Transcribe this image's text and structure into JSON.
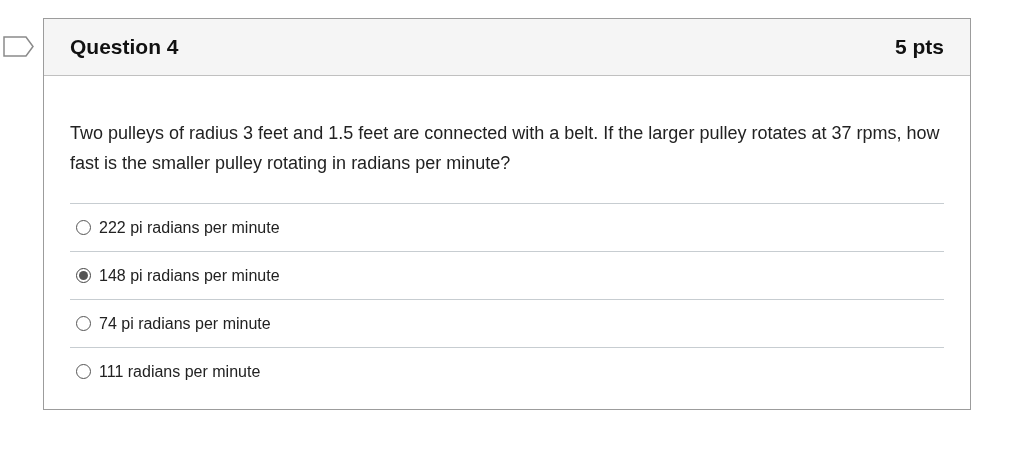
{
  "question": {
    "title": "Question 4",
    "points": "5 pts",
    "text": "Two pulleys of radius 3 feet and 1.5 feet are connected with a belt.  If the larger pulley rotates at 37 rpms, how fast is the smaller pulley rotating in radians per minute?",
    "answers": [
      {
        "label": "222 pi radians per minute",
        "selected": false
      },
      {
        "label": "148 pi radians per minute",
        "selected": true
      },
      {
        "label": "74 pi radians per minute",
        "selected": false
      },
      {
        "label": "111 radians per minute",
        "selected": false
      }
    ]
  }
}
